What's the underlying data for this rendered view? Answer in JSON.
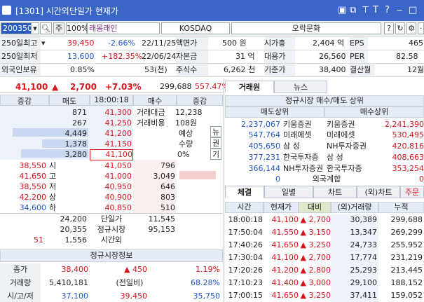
{
  "window": {
    "title": "[1301] 시간외단일가 현재가"
  },
  "toolbar": {
    "code": "200350",
    "pct": "100%",
    "name": "래몽래인",
    "market": "KOSDAQ",
    "sector": "오락문화",
    "ju": "주"
  },
  "info": {
    "row1": {
      "l1": "250일최고",
      "price": "39,450",
      "pct": "-2.66%",
      "date": "22/11/25",
      "l2": "액면가",
      "v2": "500 원",
      "l3": "시가총",
      "v3": "2,404 억",
      "l4": "EPS",
      "v4": "465"
    },
    "row2": {
      "l1": "250일최저",
      "price": "13,600",
      "pct": "+182.35%",
      "date": "22/06/24",
      "l2": "자본금",
      "v2": "31 억",
      "l3": "대용가",
      "v3": "26,560",
      "l4": "PER",
      "v4": "82.58"
    },
    "row3": {
      "l1": "외국인보유",
      "v1": "0.85%",
      "v1b": "53(천)",
      "l2": "주식수",
      "v2": "6,262 천",
      "l3": "기준가",
      "v3": "38,400",
      "l4": "결산월",
      "v4": "12월"
    }
  },
  "quote": {
    "price": "41,100",
    "change": "2,700",
    "pct": "+7.03%",
    "volume": "299,688",
    "ratio": "557.47%"
  },
  "orderbook": {
    "headers": [
      "증감",
      "매도",
      "18:00:18",
      "매수",
      "증감"
    ],
    "asks": [
      {
        "qty": "871",
        "price": "41,300"
      },
      {
        "qty": "267",
        "price": "41,250"
      },
      {
        "qty": "4,449",
        "price": "41,200"
      },
      {
        "qty": "1,378",
        "price": "41,150"
      },
      {
        "qty": "3,280",
        "price": "41,100"
      }
    ],
    "ask_info": {
      "l1": "거래대금",
      "v1": "12,238",
      "l2": "거래비용",
      "v2": "108원",
      "l3": "예상",
      "l4": "수량",
      "v4": "0%",
      "news": "뉴",
      "kwon": "권",
      "gi": "기"
    },
    "bids": [
      {
        "price": "41,050",
        "qty": "796"
      },
      {
        "price": "41,000",
        "qty": "3,049"
      },
      {
        "price": "40,950",
        "qty": "646"
      },
      {
        "price": "40,900",
        "qty": "803"
      },
      {
        "price": "40,850",
        "qty": "510"
      }
    ],
    "left_stats": [
      {
        "price": "38,550",
        "tag": "시"
      },
      {
        "price": "41,650",
        "tag": "고"
      },
      {
        "price": "38,550",
        "tag": "저"
      },
      {
        "price": "42,200",
        "tag": "상"
      },
      {
        "price": "34,600",
        "tag": "하"
      }
    ],
    "footer": [
      {
        "a": "",
        "b": "24,200",
        "c": "단일가",
        "d": "11,545"
      },
      {
        "a": "",
        "b": "20,355",
        "c": "정규시장",
        "d": "95,153"
      },
      {
        "a": "51",
        "b": "1,556",
        "c": "시간외",
        "d": ""
      }
    ]
  },
  "regular": {
    "title": "정규시장정보",
    "rows": [
      {
        "l": "종가",
        "v1": "38,400",
        "v2": "▲ 450",
        "v3": "1.19%"
      },
      {
        "l": "거래량",
        "v1": "5,410,181",
        "v2": "(전일비)",
        "v3": "68.28%"
      },
      {
        "l": "시/고/저",
        "v1": "37,100",
        "v2": "39,450",
        "v3": "35,750"
      }
    ]
  },
  "broker": {
    "tabs": [
      "거래원",
      "뉴스"
    ],
    "title": "정규시장 매수/매도 상위",
    "sell_h": "매도상위",
    "buy_h": "매수상위",
    "rows": [
      {
        "sq": "2,237,067",
        "sn": "키움증권",
        "bn": "키움증권",
        "bq": "2,241,390"
      },
      {
        "sq": "547,764",
        "sn": "미래에셋",
        "bn": "미래에셋",
        "bq": "530,495"
      },
      {
        "sq": "405,650",
        "sn": "삼  성",
        "bn": "NH투자증권",
        "bq": "420,816"
      },
      {
        "sq": "377,231",
        "sn": "한국투자증",
        "bn": "삼  성",
        "bq": "408,663"
      },
      {
        "sq": "366,144",
        "sn": "NH투자증권",
        "bn": "한국투자증",
        "bq": "353,254"
      }
    ],
    "foreign": {
      "sq": "0",
      "label": "외국계합",
      "bq": "0"
    }
  },
  "ticks": {
    "tabs": [
      "체결",
      "일별",
      "차트",
      "(외)차트",
      "주문"
    ],
    "headers": [
      "시간",
      "현재가",
      "대비",
      "(외)거래량",
      "누적"
    ],
    "rows": [
      {
        "t": "18:00:18",
        "p": "41,100",
        "d": "▲ 2,700",
        "v": "30,389",
        "c": "299,688"
      },
      {
        "t": "17:50:04",
        "p": "41,550",
        "d": "▲ 3,150",
        "v": "13,347",
        "c": "269,299"
      },
      {
        "t": "17:40:26",
        "p": "41,650",
        "d": "▲ 3,250",
        "v": "24,733",
        "c": "255,952"
      },
      {
        "t": "17:30:04",
        "p": "41,100",
        "d": "▲ 2,700",
        "v": "17,774",
        "c": "231,219"
      },
      {
        "t": "17:20:26",
        "p": "41,200",
        "d": "▲ 2,800",
        "v": "25,293",
        "c": "213,445"
      },
      {
        "t": "17:10:23",
        "p": "41,400",
        "d": "▲ 3,000",
        "v": "29,100",
        "c": "188,152"
      },
      {
        "t": "17:00:15",
        "p": "41,650",
        "d": "▲ 3,250",
        "v": "37,411",
        "c": "159,052"
      }
    ]
  },
  "colors": {
    "up": "#d8141c",
    "down": "#1f55c8",
    "title": "#3a66c8"
  }
}
